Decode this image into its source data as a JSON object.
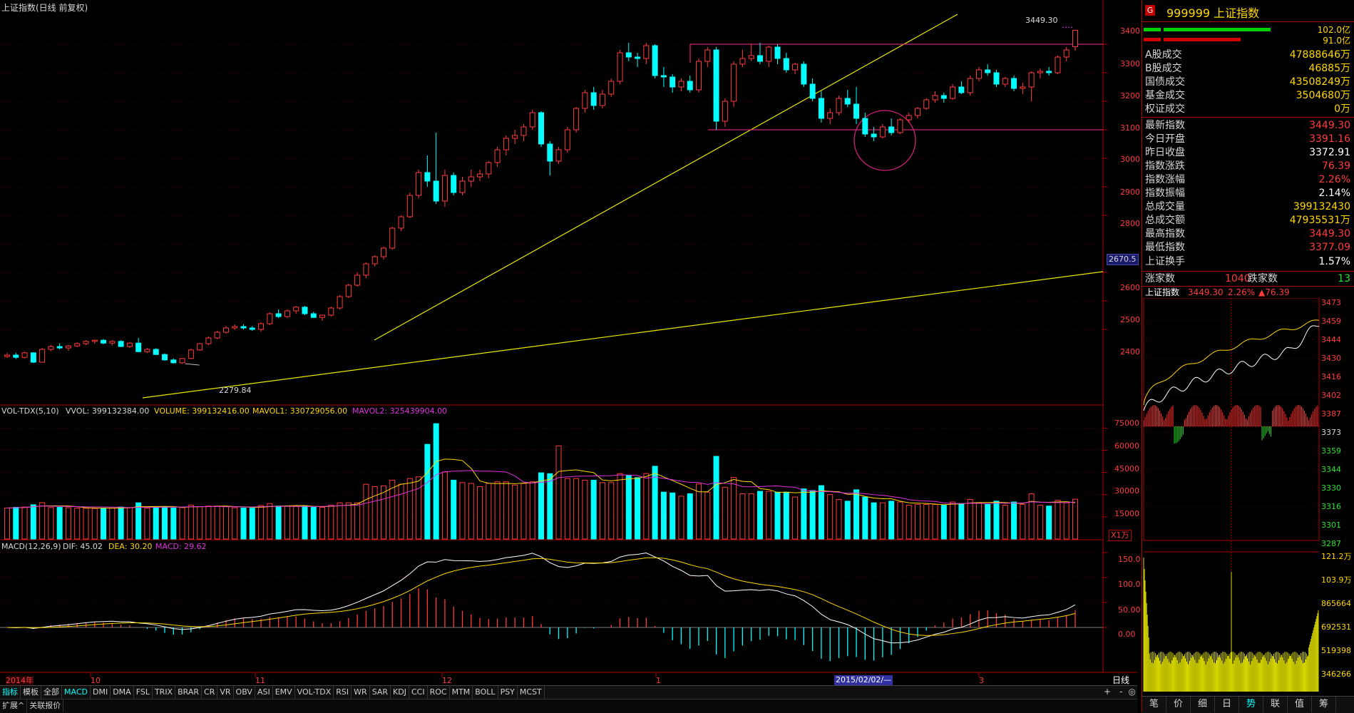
{
  "header": {
    "title": "上证指数(日线 前复权)",
    "last_marker": "3449.30",
    "low_marker": "2279.84",
    "level_tag": "2670.5"
  },
  "vol_header": {
    "name": "VOL-TDX(5,10)",
    "vvol": "VVOL: 399132384.00",
    "volume": "VOLUME: 399132416.00",
    "mavol1": "MAVOL1: 330729056.00",
    "mavol2": "MAVOL2: 325439904.00",
    "unit": "X1万"
  },
  "macd_header": {
    "name": "MACD(12,26,9)",
    "dif": "DIF: 45.02",
    "dea": "DEA: 30.20",
    "macd": "MACD: 29.62"
  },
  "time_axis": {
    "year": "2014年",
    "months": [
      "10",
      "11",
      "12",
      "1",
      "3"
    ],
    "cursor_date": "2015/02/02/—",
    "period": "日线"
  },
  "price_axis": [
    "3400",
    "3300",
    "3200",
    "3100",
    "3000",
    "2900",
    "2800",
    "2600",
    "2500",
    "2400"
  ],
  "vol_axis": [
    "75000",
    "60000",
    "45000",
    "30000",
    "15000"
  ],
  "macd_axis": [
    "150.0",
    "100.0",
    "50.00",
    "0.00"
  ],
  "tabs": [
    "指标",
    "模板",
    "全部",
    "MACD",
    "DMI",
    "DMA",
    "FSL",
    "TRIX",
    "BRAR",
    "CR",
    "VR",
    "OBV",
    "ASI",
    "EMV",
    "VOL-TDX",
    "RSI",
    "WR",
    "SAR",
    "KDJ",
    "CCI",
    "ROC",
    "MTM",
    "BOLL",
    "PSY",
    "MCST"
  ],
  "tabs2": [
    "扩展^",
    "关联报价"
  ],
  "scroll_controls": [
    "+",
    "-",
    "◎"
  ],
  "sidebar": {
    "badge": "G",
    "code_name": "999999 上证指数",
    "bar_labels": [
      "102.0亿",
      "91.0亿"
    ],
    "rows": [
      {
        "k": "A股成交",
        "v": "47888646万",
        "c": "yel"
      },
      {
        "k": "B股成交",
        "v": "46885万",
        "c": "yel"
      },
      {
        "k": "国债成交",
        "v": "43508249万",
        "c": "yel"
      },
      {
        "k": "基金成交",
        "v": "3504680万",
        "c": "yel"
      },
      {
        "k": "权证成交",
        "v": "0万",
        "c": "yel"
      },
      {
        "k": "最新指数",
        "v": "3449.30",
        "c": "red"
      },
      {
        "k": "今日开盘",
        "v": "3391.16",
        "c": "red"
      },
      {
        "k": "昨日收盘",
        "v": "3372.91",
        "c": "wht"
      },
      {
        "k": "指数涨跌",
        "v": "76.39",
        "c": "red"
      },
      {
        "k": "指数涨幅",
        "v": "2.26%",
        "c": "red"
      },
      {
        "k": "指数振幅",
        "v": "2.14%",
        "c": "wht"
      },
      {
        "k": "总成交量",
        "v": "399132430",
        "c": "yel"
      },
      {
        "k": "总成交额",
        "v": "47935531万",
        "c": "yel"
      },
      {
        "k": "最高指数",
        "v": "3449.30",
        "c": "red"
      },
      {
        "k": "最低指数",
        "v": "3377.09",
        "c": "red"
      },
      {
        "k": "上证换手",
        "v": "1.57%",
        "c": "wht"
      }
    ],
    "updown": {
      "up_label": "涨家数",
      "up": "1040",
      "down_label": "跌家数",
      "down": "13"
    },
    "mini_title": "上证指数",
    "mini_last": "3449.30",
    "mini_pct": "2.26%",
    "mini_chg": "▲76.39",
    "mini_price_axis": [
      "3473",
      "3459",
      "3444",
      "3430",
      "3416",
      "3402",
      "3387",
      "3373",
      "3359",
      "3344",
      "3330",
      "3316",
      "3301",
      "3287"
    ],
    "mini_vol_axis": [
      "121.2万",
      "103.9万",
      "865664",
      "692531",
      "519398",
      "346266",
      "173133"
    ],
    "bottom_tabs": [
      "笔",
      "价",
      "细",
      "日",
      "势",
      "联",
      "值",
      "筹"
    ]
  },
  "chart_data": {
    "type": "candlestick",
    "title": "上证指数(日线 前复权)",
    "annotations": [
      "3449.30",
      "2279.84"
    ],
    "ohlc_approx": [
      [
        2305,
        2318,
        2300,
        2310
      ],
      [
        2310,
        2318,
        2296,
        2302
      ],
      [
        2302,
        2322,
        2298,
        2318
      ],
      [
        2318,
        2320,
        2282,
        2285
      ],
      [
        2285,
        2335,
        2284,
        2330
      ],
      [
        2330,
        2345,
        2324,
        2340
      ],
      [
        2340,
        2352,
        2330,
        2335
      ],
      [
        2335,
        2345,
        2325,
        2342
      ],
      [
        2342,
        2355,
        2338,
        2350
      ],
      [
        2350,
        2362,
        2345,
        2358
      ],
      [
        2358,
        2365,
        2350,
        2362
      ],
      [
        2362,
        2366,
        2348,
        2352
      ],
      [
        2352,
        2362,
        2344,
        2358
      ],
      [
        2358,
        2362,
        2338,
        2340
      ],
      [
        2340,
        2356,
        2335,
        2352
      ],
      [
        2352,
        2370,
        2320,
        2322
      ],
      [
        2322,
        2335,
        2318,
        2330
      ],
      [
        2330,
        2334,
        2310,
        2312
      ],
      [
        2312,
        2316,
        2290,
        2293
      ],
      [
        2293,
        2298,
        2280,
        2283
      ],
      [
        2283,
        2300,
        2279,
        2298
      ],
      [
        2298,
        2332,
        2296,
        2328
      ],
      [
        2328,
        2352,
        2325,
        2350
      ],
      [
        2350,
        2375,
        2345,
        2370
      ],
      [
        2370,
        2395,
        2365,
        2390
      ],
      [
        2390,
        2412,
        2385,
        2405
      ],
      [
        2405,
        2418,
        2398,
        2410
      ],
      [
        2410,
        2418,
        2400,
        2405
      ],
      [
        2405,
        2412,
        2395,
        2400
      ],
      [
        2400,
        2425,
        2392,
        2420
      ],
      [
        2420,
        2460,
        2415,
        2455
      ],
      [
        2455,
        2470,
        2440,
        2445
      ],
      [
        2445,
        2470,
        2440,
        2465
      ],
      [
        2465,
        2482,
        2455,
        2478
      ],
      [
        2478,
        2482,
        2450,
        2455
      ],
      [
        2455,
        2462,
        2440,
        2442
      ],
      [
        2442,
        2452,
        2430,
        2450
      ],
      [
        2450,
        2480,
        2445,
        2475
      ],
      [
        2475,
        2520,
        2470,
        2515
      ],
      [
        2515,
        2560,
        2510,
        2555
      ],
      [
        2555,
        2600,
        2550,
        2590
      ],
      [
        2590,
        2635,
        2580,
        2630
      ],
      [
        2630,
        2660,
        2620,
        2655
      ],
      [
        2655,
        2690,
        2645,
        2685
      ],
      [
        2685,
        2760,
        2680,
        2755
      ],
      [
        2755,
        2800,
        2745,
        2795
      ],
      [
        2795,
        2880,
        2790,
        2870
      ],
      [
        2870,
        2960,
        2860,
        2950
      ],
      [
        2950,
        3010,
        2900,
        2920
      ],
      [
        2920,
        3090,
        2840,
        2850
      ],
      [
        2850,
        2960,
        2830,
        2940
      ],
      [
        2940,
        2950,
        2870,
        2880
      ],
      [
        2880,
        2935,
        2870,
        2920
      ],
      [
        2920,
        2960,
        2900,
        2935
      ],
      [
        2935,
        2960,
        2920,
        2945
      ],
      [
        2945,
        2990,
        2930,
        2985
      ],
      [
        2985,
        3040,
        2970,
        3030
      ],
      [
        3030,
        3080,
        3010,
        3070
      ],
      [
        3070,
        3100,
        3050,
        3080
      ],
      [
        3080,
        3120,
        3060,
        3110
      ],
      [
        3110,
        3170,
        3100,
        3160
      ],
      [
        3160,
        3165,
        3040,
        3050
      ],
      [
        3050,
        3060,
        2940,
        2990
      ],
      [
        2990,
        3040,
        2980,
        3030
      ],
      [
        3030,
        3110,
        3020,
        3100
      ],
      [
        3100,
        3180,
        3090,
        3175
      ],
      [
        3175,
        3240,
        3160,
        3230
      ],
      [
        3230,
        3250,
        3170,
        3185
      ],
      [
        3185,
        3240,
        3175,
        3225
      ],
      [
        3225,
        3280,
        3215,
        3270
      ],
      [
        3270,
        3380,
        3260,
        3370
      ],
      [
        3370,
        3405,
        3340,
        3355
      ],
      [
        3355,
        3370,
        3320,
        3350
      ],
      [
        3350,
        3405,
        3330,
        3395
      ],
      [
        3395,
        3400,
        3280,
        3290
      ],
      [
        3290,
        3320,
        3250,
        3285
      ],
      [
        3285,
        3295,
        3230,
        3250
      ],
      [
        3250,
        3280,
        3235,
        3270
      ],
      [
        3270,
        3290,
        3230,
        3240
      ],
      [
        3240,
        3350,
        3230,
        3340
      ],
      [
        3340,
        3390,
        3320,
        3380
      ],
      [
        3380,
        3390,
        3100,
        3130
      ],
      [
        3130,
        3210,
        3110,
        3200
      ],
      [
        3200,
        3340,
        3180,
        3330
      ],
      [
        3330,
        3380,
        3320,
        3350
      ],
      [
        3350,
        3400,
        3340,
        3360
      ],
      [
        3360,
        3405,
        3330,
        3340
      ],
      [
        3340,
        3395,
        3320,
        3390
      ],
      [
        3390,
        3400,
        3330,
        3350
      ],
      [
        3350,
        3370,
        3300,
        3310
      ],
      [
        3310,
        3335,
        3295,
        3330
      ],
      [
        3330,
        3340,
        3250,
        3260
      ],
      [
        3260,
        3280,
        3200,
        3210
      ],
      [
        3210,
        3235,
        3125,
        3140
      ],
      [
        3140,
        3175,
        3120,
        3160
      ],
      [
        3160,
        3220,
        3150,
        3210
      ],
      [
        3210,
        3240,
        3180,
        3190
      ],
      [
        3190,
        3250,
        3120,
        3140
      ],
      [
        3140,
        3160,
        3075,
        3085
      ],
      [
        3085,
        3110,
        3060,
        3075
      ],
      [
        3075,
        3120,
        3070,
        3110
      ],
      [
        3110,
        3140,
        3080,
        3090
      ],
      [
        3090,
        3140,
        3085,
        3135
      ],
      [
        3135,
        3160,
        3125,
        3150
      ],
      [
        3150,
        3180,
        3140,
        3175
      ],
      [
        3175,
        3210,
        3170,
        3205
      ],
      [
        3205,
        3235,
        3195,
        3220
      ],
      [
        3220,
        3230,
        3195,
        3210
      ],
      [
        3210,
        3260,
        3205,
        3250
      ],
      [
        3250,
        3270,
        3225,
        3230
      ],
      [
        3230,
        3290,
        3220,
        3280
      ],
      [
        3280,
        3320,
        3270,
        3310
      ],
      [
        3310,
        3330,
        3290,
        3300
      ],
      [
        3300,
        3310,
        3250,
        3260
      ],
      [
        3260,
        3285,
        3250,
        3280
      ],
      [
        3280,
        3290,
        3235,
        3245
      ],
      [
        3245,
        3265,
        3225,
        3250
      ],
      [
        3250,
        3305,
        3200,
        3300
      ],
      [
        3300,
        3315,
        3280,
        3305
      ],
      [
        3305,
        3320,
        3290,
        3300
      ],
      [
        3300,
        3360,
        3295,
        3355
      ],
      [
        3355,
        3390,
        3340,
        3380
      ],
      [
        3391,
        3449,
        3377,
        3449
      ]
    ],
    "lines": [
      {
        "name": "上升趋势线",
        "from": [
          2279.84,
          "10月下旬"
        ],
        "to": "3449.30 附近"
      },
      {
        "name": "长期支撑线",
        "value_end": 2670.5
      }
    ],
    "horizontal_levels": [
      3400,
      3100
    ],
    "volume_unit": "X1万",
    "volume_ma": {
      "MAVOL1": 330729056.0,
      "MAVOL2": 325439904.0
    },
    "macd_last": {
      "DIF": 45.02,
      "DEA": 30.2,
      "MACD": 29.62
    },
    "ylim": [
      2240,
      3480
    ]
  },
  "colors": {
    "up": "#ff3b3b",
    "down": "#00ffff",
    "trend": "#e8e800",
    "level": "#d0207a",
    "ma1": "#ffd700",
    "ma2": "#e030e0",
    "axis": "#b00000"
  }
}
